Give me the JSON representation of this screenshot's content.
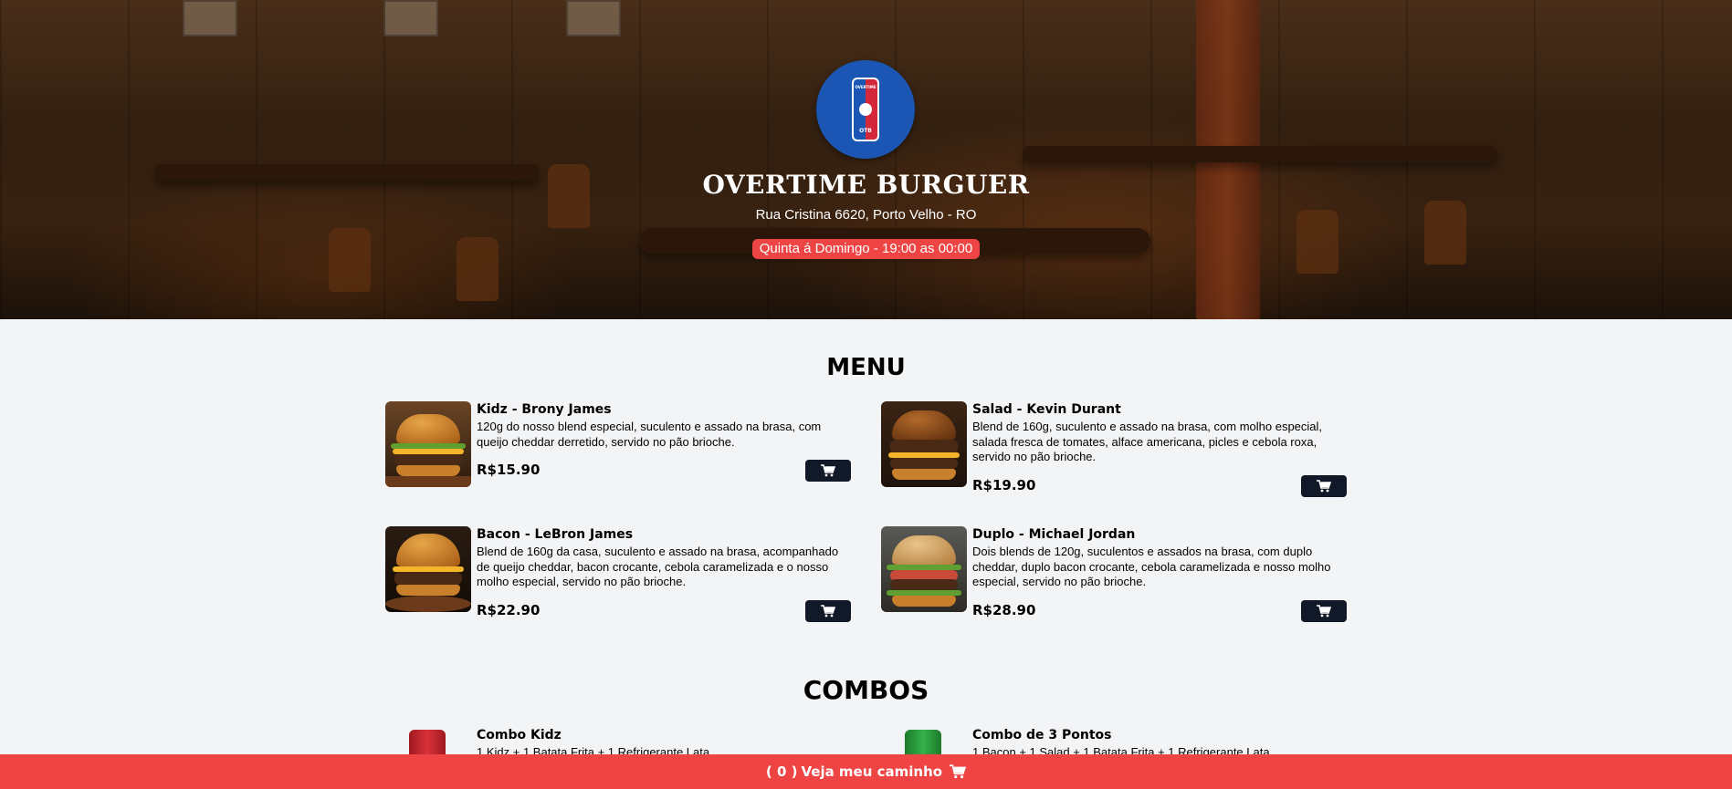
{
  "hero": {
    "logo_text_top": "OVERTIME",
    "logo_text_bottom": "OTB",
    "title": "OVERTIME BURGUER",
    "address": "Rua Cristina 6620, Porto Velho - RO",
    "hours": "Quinta á Domingo - 19:00 as 00:00"
  },
  "menu": {
    "title": "MENU",
    "items": [
      {
        "name": "Kidz - Brony James",
        "description": "120g do nosso blend especial, suculento e assado na brasa, com queijo cheddar derretido, servido no pão brioche.",
        "price": "R$15.90"
      },
      {
        "name": "Salad - Kevin Durant",
        "description": "Blend de 160g, suculento e assado na brasa, com molho especial, salada fresca de tomates, alface americana, picles e cebola roxa, servido no pão brioche.",
        "price": "R$19.90"
      },
      {
        "name": "Bacon - LeBron James",
        "description": "Blend de 160g da casa, suculento e assado na brasa, acompanhado de queijo cheddar, bacon crocante, cebola caramelizada e o nosso molho especial, servido no pão brioche.",
        "price": "R$22.90"
      },
      {
        "name": "Duplo - Michael Jordan",
        "description": "Dois blends de 120g, suculentos e assados na brasa, com duplo cheddar, duplo bacon crocante, cebola caramelizada e nosso molho especial, servido no pão brioche.",
        "price": "R$28.90"
      }
    ]
  },
  "combos": {
    "title": "COMBOS",
    "items": [
      {
        "name": "Combo Kidz",
        "description": "1 Kidz + 1 Batata Frita + 1 Refrigerante Lata"
      },
      {
        "name": "Combo de 3 Pontos",
        "description": "1 Bacon + 1 Salad + 1 Batata Frita + 1 Refrigerante Lata"
      }
    ]
  },
  "cart_bar": {
    "count": "( 0 )",
    "label": "Veja meu caminho"
  },
  "colors": {
    "accent_red": "#ef4444",
    "dark_button": "#111827",
    "logo_blue": "#1b56b4"
  },
  "icons": [
    "cart-icon"
  ]
}
